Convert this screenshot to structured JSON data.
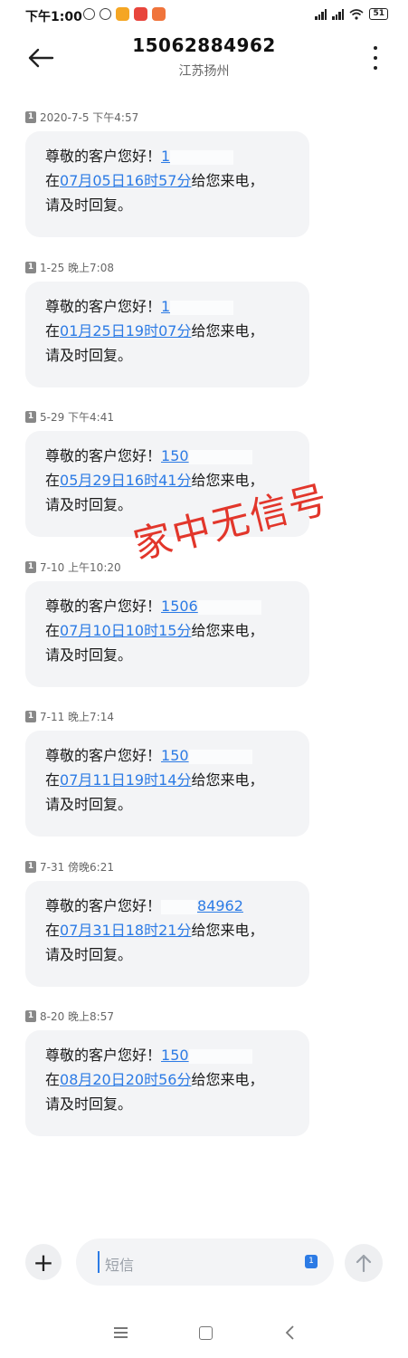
{
  "status_bar": {
    "time": "下午1:00",
    "battery": "51"
  },
  "header": {
    "title": "15062884962",
    "subtitle": "江苏扬州"
  },
  "messages": [
    {
      "meta": "2020-7-5 下午4:57",
      "greeting": "尊敬的客户您好！",
      "phone_visible": "1",
      "phone_tail": "",
      "prefix": "在",
      "datetime": "07月05日16时57分",
      "suffix": "给您来电，",
      "line3": "请及时回复。"
    },
    {
      "meta": "1-25 晚上7:08",
      "greeting": "尊敬的客户您好！",
      "phone_visible": "1",
      "phone_tail": "",
      "prefix": "在",
      "datetime": "01月25日19时07分",
      "suffix": "给您来电，",
      "line3": "请及时回复。"
    },
    {
      "meta": "5-29 下午4:41",
      "greeting": "尊敬的客户您好！",
      "phone_visible": "150",
      "phone_tail": "",
      "prefix": "在",
      "datetime": "05月29日16时41分",
      "suffix": "给您来电，",
      "line3": "请及时回复。"
    },
    {
      "meta": "7-10 上午10:20",
      "greeting": "尊敬的客户您好！",
      "phone_visible": "1506",
      "phone_tail": "",
      "prefix": "在",
      "datetime": "07月10日10时15分",
      "suffix": "给您来电，",
      "line3": "请及时回复。"
    },
    {
      "meta": "7-11 晚上7:14",
      "greeting": "尊敬的客户您好！",
      "phone_visible": "150",
      "phone_tail": "",
      "prefix": "在",
      "datetime": "07月11日19时14分",
      "suffix": "给您来电，",
      "line3": "请及时回复。"
    },
    {
      "meta": "7-31 傍晚6:21",
      "greeting": "尊敬的客户您好！",
      "phone_visible": "",
      "phone_tail": "84962",
      "prefix": "在",
      "datetime": "07月31日18时21分",
      "suffix": "给您来电，",
      "line3": "请及时回复。"
    },
    {
      "meta": "8-20 晚上8:57",
      "greeting": "尊敬的客户您好！",
      "phone_visible": "150",
      "phone_tail": "",
      "prefix": "在",
      "datetime": "08月20日20时56分",
      "suffix": "给您来电，",
      "line3": "请及时回复。"
    }
  ],
  "watermark": "家中无信号",
  "compose": {
    "placeholder": "短信",
    "sim": "1"
  },
  "colors": {
    "link": "#2c7be5",
    "bubble": "#f3f4f6",
    "watermark": "#e2362b"
  }
}
